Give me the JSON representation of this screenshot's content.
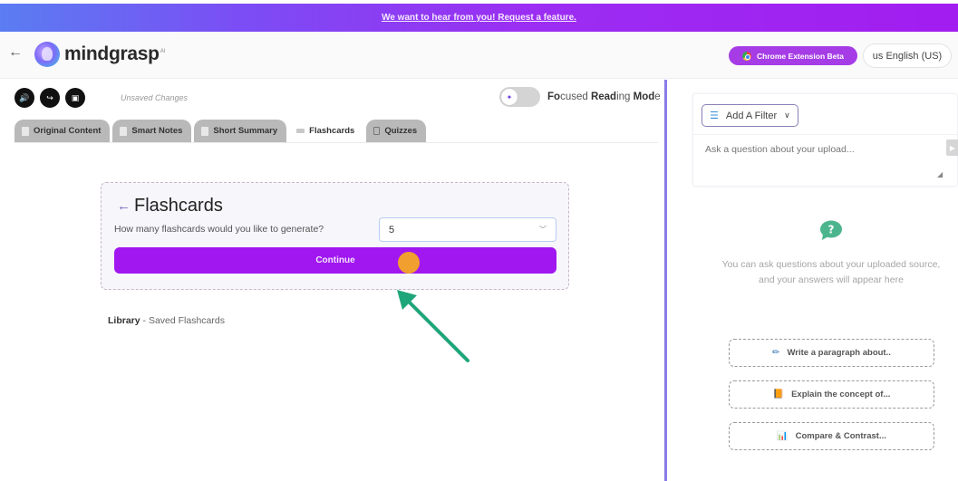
{
  "banner": {
    "text": "We want to hear from you! Request a feature."
  },
  "header": {
    "brand": "mindgrasp",
    "brand_suffix": "AI",
    "chrome_button": "Chrome Extension Beta",
    "language_button": "us  English (US)"
  },
  "toolbar": {
    "icons": [
      "speaker-icon",
      "share-icon",
      "save-icon"
    ],
    "status": "Unsaved Changes",
    "focus_mode": {
      "pre": "Fo",
      "b1": "cused ",
      "b2": "Read",
      "mid": "ing ",
      "b3": "Mod",
      "post": "e",
      "enabled": false
    }
  },
  "tabs": [
    {
      "label": "Original Content",
      "active": false
    },
    {
      "label": "Smart Notes",
      "active": false
    },
    {
      "label": "Short Summary",
      "active": false
    },
    {
      "label": "Flashcards",
      "active": true
    },
    {
      "label": "Quizzes",
      "active": false
    }
  ],
  "flashcards": {
    "title": "Flashcards",
    "question": "How many flashcards would you like to generate?",
    "selected_count": "5",
    "continue_label": "Continue"
  },
  "library": {
    "label": "Library",
    "suffix": " - Saved Flashcards"
  },
  "chat": {
    "filter_label": "Add A Filter",
    "input_placeholder": "Ask a question about your upload...",
    "empty_message": "You can ask questions about your uploaded source, and your answers will appear here",
    "prompts": [
      {
        "icon": "pencil-icon",
        "glyph": "✏",
        "label": "Write a paragraph about.."
      },
      {
        "icon": "book-icon",
        "glyph": "📙",
        "label": "Explain the concept of..."
      },
      {
        "icon": "chart-icon",
        "glyph": "📊",
        "label": "Compare & Contrast..."
      }
    ]
  },
  "colors": {
    "accent_purple": "#a017f0",
    "chrome_button": "#a53ce6",
    "divider": "#8a7de6",
    "help_green": "#4cb58e",
    "annotation_arrow": "#1fa57a",
    "cursor_highlight": "#f5a623"
  }
}
